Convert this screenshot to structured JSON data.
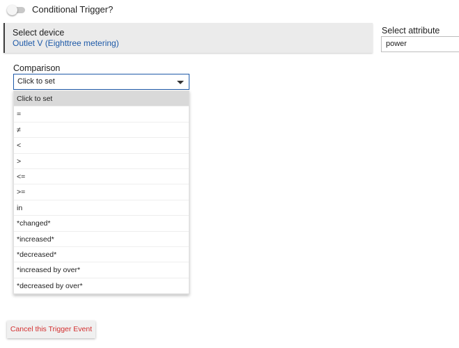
{
  "conditional_trigger": {
    "label": "Conditional Trigger?",
    "enabled": false
  },
  "device": {
    "label": "Select device",
    "value": "Outlet V (Eighttree metering)"
  },
  "attribute": {
    "label": "Select attribute",
    "value": "power"
  },
  "comparison": {
    "label": "Comparison",
    "selected": "Click to set",
    "options": [
      "Click to set",
      "=",
      "≠",
      "<",
      ">",
      "<=",
      ">=",
      "in",
      "*changed*",
      "*increased*",
      "*decreased*",
      "*increased by over*",
      "*decreased by over*"
    ]
  },
  "actions": {
    "cancel_label": "Cancel this Trigger Event"
  },
  "colors": {
    "accent": "#1e5aa8",
    "danger": "#d32f2f",
    "device_box_bg": "#ebebeb",
    "selected_option_bg": "#d9d9d9"
  }
}
